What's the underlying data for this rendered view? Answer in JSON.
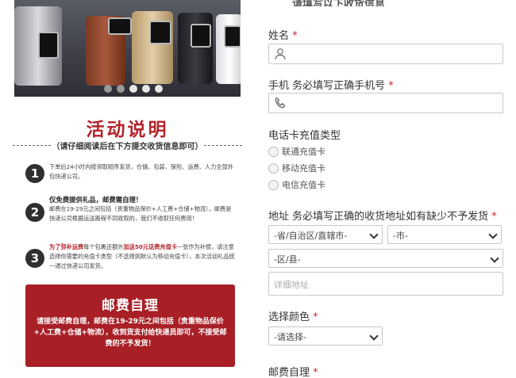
{
  "left": {
    "carousel": {
      "dot_count": 5,
      "active_dot": 2
    },
    "activity_title": "活动说明",
    "activity_subtitle": "（请仔细阅读后在下方提交收货信息即可）",
    "steps": [
      {
        "num": "1",
        "head": "",
        "text": "下单后24小时内按领取顺序发货，仓储、包装、保险、运费、人力全部外包快递公司。"
      },
      {
        "num": "2",
        "head": "仅免费提供礼品，邮费需自理！",
        "text": "邮费在19-29元之间包括（贵重物品保价+人工费+仓储+物流），邮费是快递公司根据运送路程不同收取的，我们不收取任何费用！"
      },
      {
        "num": "3",
        "head_red_1": "为了弥补运费",
        "head_mid": "每个包裹还额外",
        "head_red_2": "加送50元话费充值卡",
        "text": "一张作为补偿，请注意选择你需要的充值卡类型（不选择则默认为移动充值卡），本次活动礼品统一通过快递公司发货。"
      }
    ],
    "postage": {
      "title": "邮费自理",
      "text": "请接受邮费自理，邮费在19-29元之间包括（贵重物品保价+人工费+仓储+物流），收到货支付给快递员即可，不接受邮费的不予发货！"
    }
  },
  "right": {
    "top_cut_text": "请填写以下收货信息",
    "name_label": "姓名",
    "phone_label": "手机 务必填写正确手机号",
    "card_type_label": "电话卡充值类型",
    "card_options": [
      "联通充值卡",
      "移动充值卡",
      "电信充值卡"
    ],
    "address_label": "地址 务必填写正确的收货地址如有缺少不予发货",
    "province_placeholder": "-省/自治区/直辖市-",
    "city_placeholder": "-市-",
    "district_placeholder": "-区/县-",
    "detail_placeholder": "详细地址",
    "color_label": "选择颜色",
    "color_placeholder": "-请选择-",
    "postage_label": "邮费自理",
    "required_mark": "*"
  },
  "colors": {
    "accent_red": "#b3242a",
    "postage_box": "#a81f26",
    "border": "#c8c8c8"
  }
}
